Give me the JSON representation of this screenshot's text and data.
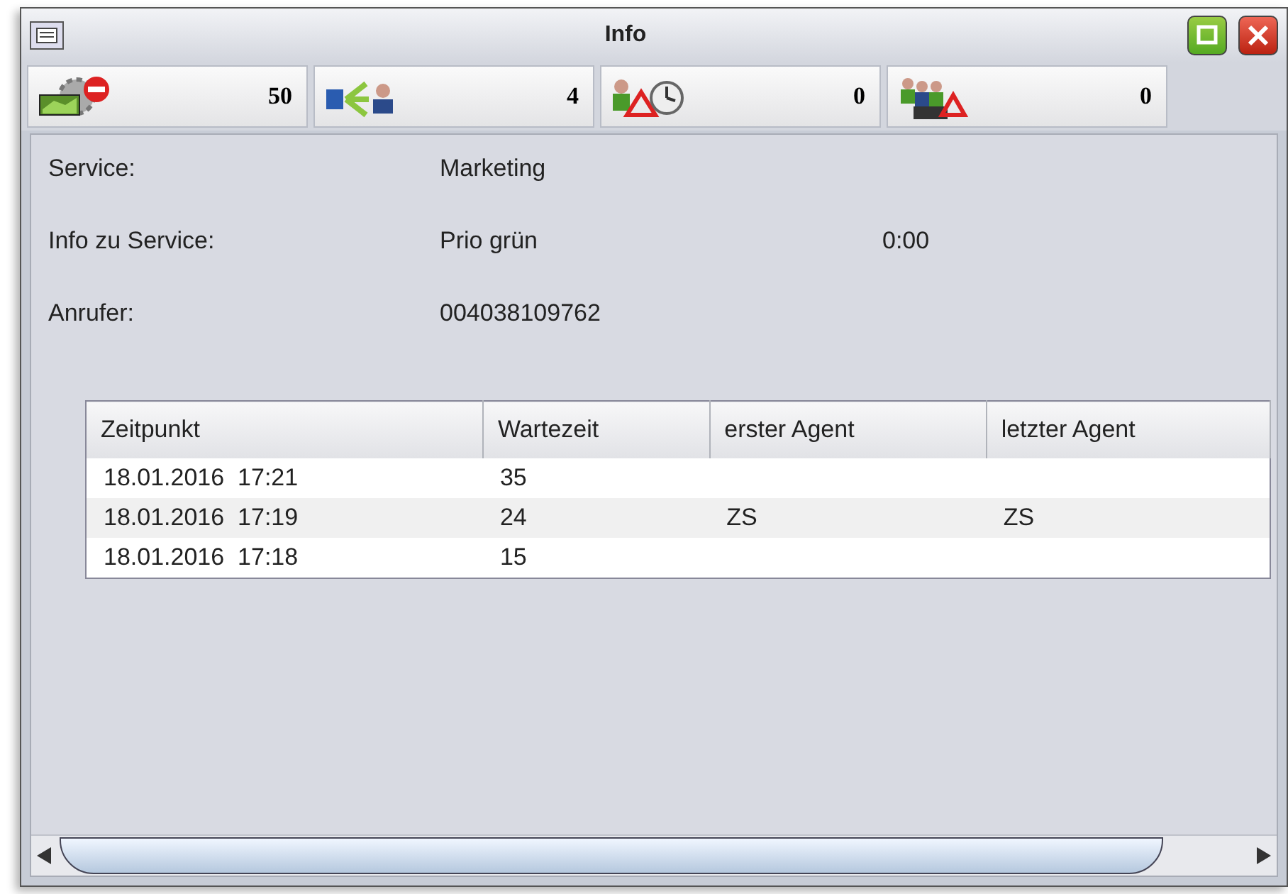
{
  "window": {
    "title": "Info"
  },
  "stats": [
    {
      "kind": "blocked",
      "value": "50"
    },
    {
      "kind": "routing",
      "value": "4"
    },
    {
      "kind": "timeout",
      "value": "0"
    },
    {
      "kind": "queue",
      "value": "0"
    }
  ],
  "fields": [
    {
      "label": "Service:",
      "value": "Marketing"
    },
    {
      "label": "Info zu Service:",
      "value": "Prio grün",
      "extra": "0:00"
    },
    {
      "label": "Anrufer:",
      "value": "004038109762"
    }
  ],
  "table": {
    "columns": [
      "Zeitpunkt",
      "Wartezeit",
      "erster Agent",
      "letzter Agent"
    ],
    "rows": [
      [
        "18.01.2016  17:21",
        "35",
        "",
        ""
      ],
      [
        "18.01.2016  17:19",
        "24",
        "ZS",
        "ZS"
      ],
      [
        "18.01.2016  17:18",
        "15",
        "",
        ""
      ]
    ]
  }
}
